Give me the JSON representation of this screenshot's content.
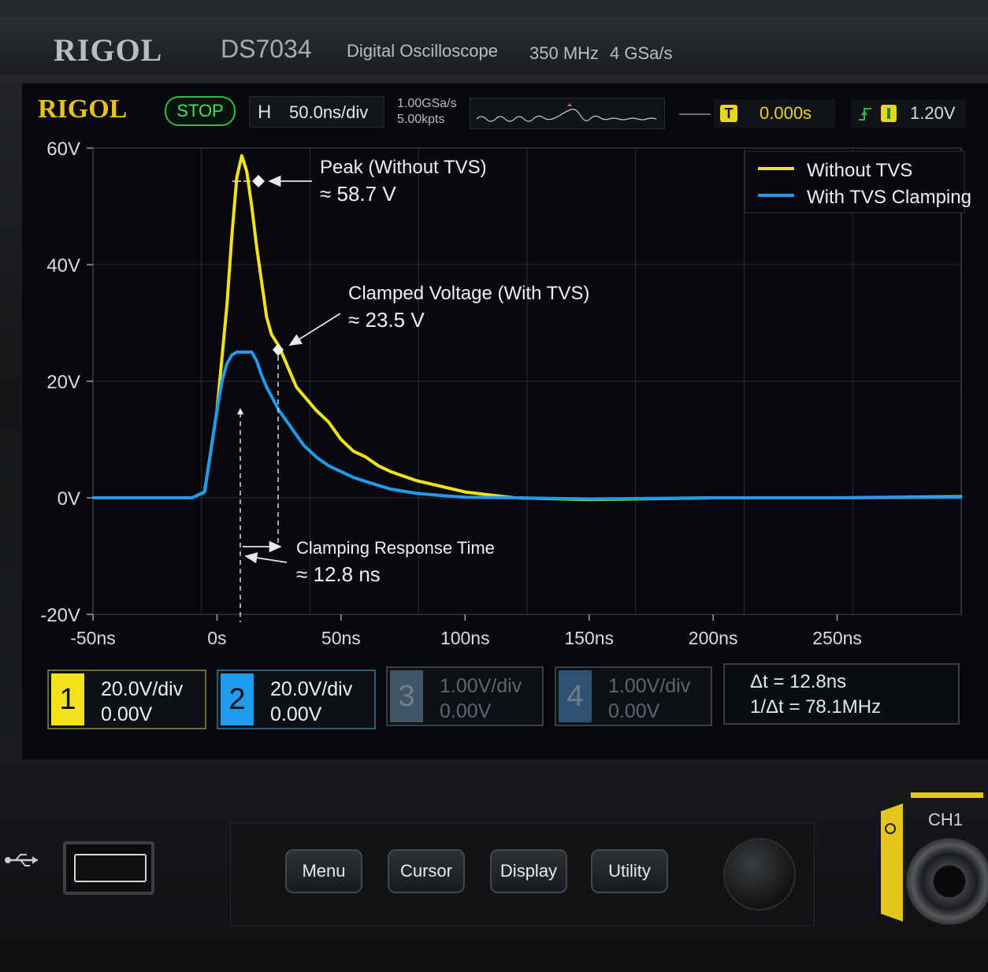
{
  "device": {
    "brand": "RIGOL",
    "model": "DS7034",
    "description": "Digital Oscilloscope",
    "bandwidth": "350 MHz",
    "sample_rate_spec": "4 GSa/s"
  },
  "status_bar": {
    "brand": "RIGOL",
    "run_state": "STOP",
    "horizontal_label": "H",
    "timebase": "50.0ns/div",
    "sample_rate": "1.00GSa/s",
    "memory_depth": "5.00kpts",
    "trigger_badge": "T",
    "trigger_time": "0.000s",
    "trigger_level": "1.20V"
  },
  "annotations": {
    "peak_title": "Peak (Without TVS)",
    "peak_value": "≈ 58.7 V",
    "clamp_title": "Clamped Voltage (With TVS)",
    "clamp_value": "≈ 23.5 V",
    "response_title": "Clamping Response Time",
    "response_value": "≈ 12.8 ns"
  },
  "channels": [
    {
      "num": "1",
      "scale": "20.0V/div",
      "offset": "0.00V",
      "color": "#f2e21c",
      "active": true
    },
    {
      "num": "2",
      "scale": "20.0V/div",
      "offset": "0.00V",
      "color": "#1f9cf0",
      "active": true
    },
    {
      "num": "3",
      "scale": "1.00V/div",
      "offset": "0.00V",
      "color": "#3f5566",
      "active": false
    },
    {
      "num": "4",
      "scale": "1.00V/div",
      "offset": "0.00V",
      "color": "#2e5272",
      "active": false
    }
  ],
  "cursor_measure": {
    "delta_t": "Δt = 12.8ns",
    "inverse_delta_t": "1/Δt = 78.1MHz"
  },
  "front_panel": {
    "buttons": [
      "Menu",
      "Cursor",
      "Display",
      "Utility"
    ],
    "channel_input_label": "CH1",
    "usb_icon": "usb-icon"
  },
  "chart_data": {
    "type": "line",
    "xlabel": "",
    "ylabel": "",
    "xlim": [
      -50,
      300
    ],
    "ylim": [
      -20,
      60
    ],
    "x_ticks": [
      "-50ns",
      "0s",
      "50ns",
      "100ns",
      "150ns",
      "200ns",
      "250ns"
    ],
    "x_tick_values": [
      -50,
      0,
      50,
      100,
      150,
      200,
      250
    ],
    "y_ticks": [
      "60V",
      "40V",
      "20V",
      "0V",
      "-20V"
    ],
    "y_tick_values": [
      60,
      40,
      20,
      0,
      -20
    ],
    "grid": true,
    "legend_position": "top-right",
    "series": [
      {
        "name": "Without TVS",
        "color": "#f2e21c",
        "x": [
          -50,
          -10,
          -5,
          0,
          4,
          6,
          8,
          10,
          12,
          14,
          16,
          18,
          20,
          22,
          25,
          28,
          32,
          36,
          40,
          45,
          50,
          55,
          60,
          65,
          70,
          80,
          90,
          100,
          120,
          150,
          200,
          250,
          300
        ],
        "y": [
          0,
          0,
          1,
          15,
          33,
          45,
          55,
          58.7,
          56,
          50,
          43,
          37,
          31,
          28,
          26,
          23,
          19,
          17,
          15,
          13,
          10,
          8,
          7,
          5.5,
          4.5,
          3,
          2,
          1,
          0,
          -0.3,
          0,
          0,
          0.2
        ]
      },
      {
        "name": "With TVS Clamping",
        "color": "#1f9cf0",
        "x": [
          -50,
          -10,
          -5,
          0,
          2,
          4,
          6,
          8,
          10,
          12,
          14,
          16,
          18,
          20,
          25,
          30,
          35,
          40,
          45,
          50,
          55,
          60,
          70,
          80,
          90,
          100,
          120,
          150,
          200,
          250,
          300
        ],
        "y": [
          0,
          0,
          1,
          15,
          20,
          23,
          24.5,
          25,
          25,
          25,
          25,
          23.5,
          21,
          19,
          15,
          12,
          9,
          7,
          5.5,
          4.5,
          3.5,
          2.8,
          1.5,
          0.8,
          0.4,
          0.1,
          0,
          -0.2,
          0,
          0,
          0.1
        ]
      }
    ]
  }
}
